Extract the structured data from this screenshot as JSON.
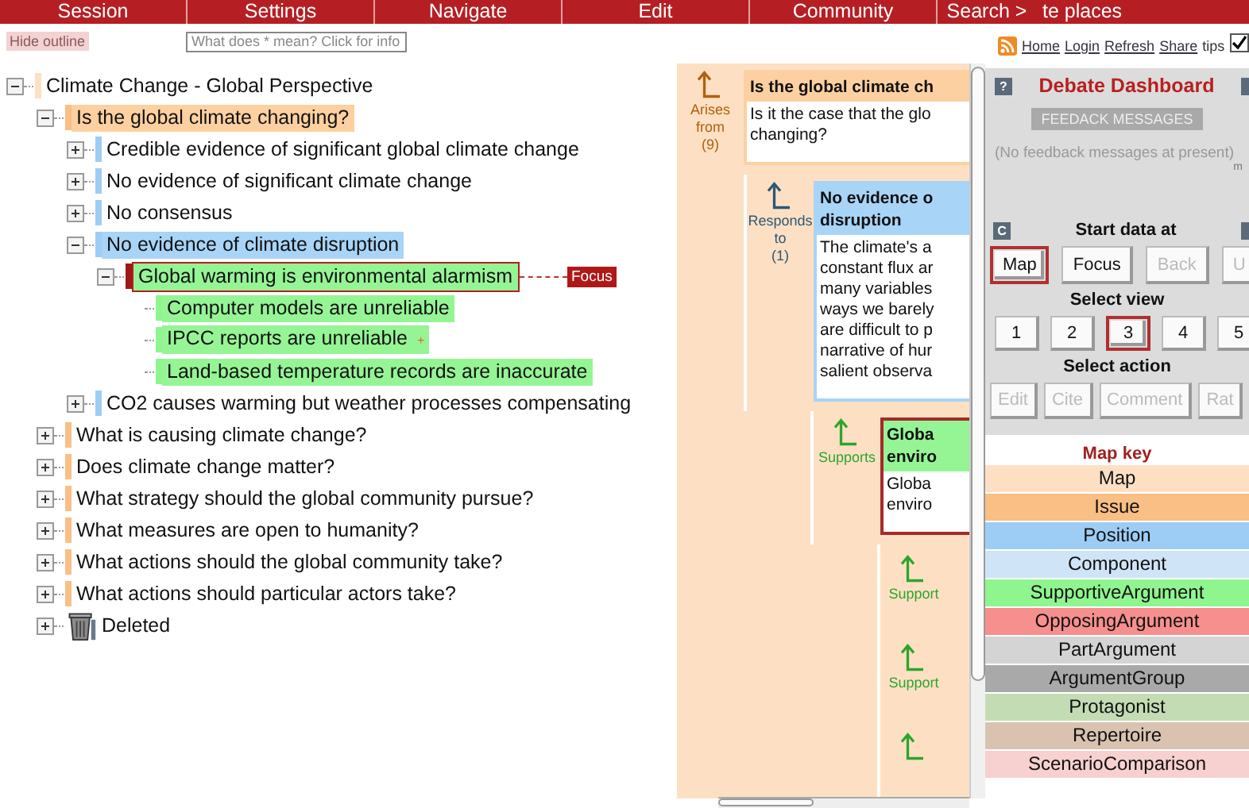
{
  "menu": [
    "Session",
    "Settings",
    "Navigate",
    "Edit",
    "Community",
    "Search >",
    "te places"
  ],
  "outline": {
    "hide_button": "Hide outline",
    "info_hint": "What does * mean? Click for info",
    "tree": [
      {
        "label": "Climate Change - Global Perspective",
        "kind": "map",
        "expanded": true,
        "highlighted": false,
        "children": [
          {
            "label": "Is the global climate changing?",
            "kind": "issue",
            "expanded": true,
            "highlighted": true,
            "children": [
              {
                "label": "Credible evidence of significant global climate change",
                "kind": "position",
                "expanded": false,
                "highlighted": false
              },
              {
                "label": "No evidence of significant climate change",
                "kind": "position",
                "expanded": false,
                "highlighted": false
              },
              {
                "label": "No consensus",
                "kind": "position",
                "expanded": false,
                "highlighted": false
              },
              {
                "label": "No evidence of climate disruption",
                "kind": "position",
                "expanded": true,
                "highlighted": true,
                "children": [
                  {
                    "label": "Global warming is environmental alarmism",
                    "kind": "supportive",
                    "expanded": true,
                    "highlighted": true,
                    "focus_tag": "Focus",
                    "children": [
                      {
                        "label": "Computer models are unreliable",
                        "kind": "supportive",
                        "highlighted": true
                      },
                      {
                        "label": "IPCC reports are unreliable",
                        "kind": "supportive",
                        "highlighted": true,
                        "marker": "+"
                      },
                      {
                        "label": "Land-based temperature records are inaccurate",
                        "kind": "supportive",
                        "highlighted": true
                      }
                    ]
                  }
                ]
              },
              {
                "label": "CO2 causes warming but weather processes compensating",
                "kind": "position",
                "expanded": false,
                "highlighted": false
              }
            ]
          },
          {
            "label": "What is causing climate change?",
            "kind": "issue",
            "expanded": false,
            "highlighted": false
          },
          {
            "label": "Does climate change matter?",
            "kind": "issue",
            "expanded": false,
            "highlighted": false
          },
          {
            "label": "What strategy should the global community pursue?",
            "kind": "issue",
            "expanded": false,
            "highlighted": false
          },
          {
            "label": "What measures are open to humanity?",
            "kind": "issue",
            "expanded": false,
            "highlighted": false
          },
          {
            "label": "What actions should the global community take?",
            "kind": "issue",
            "expanded": false,
            "highlighted": false
          },
          {
            "label": "What actions should particular actors take?",
            "kind": "issue",
            "expanded": false,
            "highlighted": false
          },
          {
            "label": "Deleted",
            "kind": "deleted",
            "expanded": false,
            "highlighted": false
          }
        ]
      }
    ]
  },
  "map": {
    "levels": [
      {
        "link": {
          "kind": "arises",
          "lines": [
            "Arises",
            "from",
            "(9)"
          ]
        },
        "node": {
          "kind": "issue",
          "focus": false,
          "title_lines": [
            "Is the global climate ch"
          ],
          "body_lines": [
            "Is it the case that the glo",
            "changing?"
          ]
        }
      },
      {
        "link": {
          "kind": "responds",
          "lines": [
            "Responds",
            "to",
            "(1)"
          ]
        },
        "node": {
          "kind": "position",
          "focus": false,
          "title_lines": [
            "No evidence o",
            "disruption"
          ],
          "body_lines": [
            "The climate's a",
            "constant flux ar",
            "many variables",
            "ways we barely",
            "are difficult to p",
            "narrative of hur",
            "salient observa"
          ]
        }
      },
      {
        "link": {
          "kind": "supports",
          "lines": [
            "Supports"
          ]
        },
        "node": {
          "kind": "supportive",
          "focus": true,
          "title_lines": [
            "Globa",
            "enviro"
          ],
          "body_lines": [
            "Globa",
            "enviro"
          ]
        }
      }
    ],
    "links": [
      {
        "kind": "supports",
        "label": "Support"
      },
      {
        "kind": "supports",
        "label": "Support"
      },
      {
        "kind": "supports"
      }
    ]
  },
  "top_links": [
    "Home",
    "Login",
    "Refresh",
    "Share"
  ],
  "tips": "tips",
  "tips_checked": true,
  "dashboard": {
    "help_icon": "?",
    "title": "Debate Dashboard",
    "feedback_button": "FEEDACK MESSAGES",
    "feedback_text": "(No feedback messages at present)",
    "feedback_more": "m",
    "section_icon": "C",
    "start_label": "Start data at",
    "start_buttons": [
      {
        "label": "Map",
        "selected": true,
        "disabled": false
      },
      {
        "label": "Focus",
        "selected": false,
        "disabled": false
      },
      {
        "label": "Back",
        "selected": false,
        "disabled": true
      },
      {
        "label": "U",
        "selected": false,
        "disabled": true
      }
    ],
    "view_label": "Select view",
    "view_buttons": [
      {
        "label": "1",
        "selected": false
      },
      {
        "label": "2",
        "selected": false
      },
      {
        "label": "3",
        "selected": true
      },
      {
        "label": "4",
        "selected": false
      },
      {
        "label": "5",
        "selected": false
      }
    ],
    "action_label": "Select action",
    "action_buttons": [
      {
        "label": "Edit",
        "disabled": true
      },
      {
        "label": "Cite",
        "disabled": true
      },
      {
        "label": "Comment",
        "disabled": true
      },
      {
        "label": "Rat",
        "disabled": true
      }
    ]
  },
  "map_key": {
    "title": "Map key",
    "items": [
      {
        "label": "Map",
        "color": "#fde0c4"
      },
      {
        "label": "Issue",
        "color": "#f9bf85"
      },
      {
        "label": "Position",
        "color": "#9dcdf5"
      },
      {
        "label": "Component",
        "color": "#cfe4f7"
      },
      {
        "label": "SupportiveArgument",
        "color": "#8ff58f"
      },
      {
        "label": "OpposingArgument",
        "color": "#f78f8f"
      },
      {
        "label": "PartArgument",
        "color": "#d4d4d4"
      },
      {
        "label": "ArgumentGroup",
        "color": "#a9a9a9"
      },
      {
        "label": "Protagonist",
        "color": "#c4dcb4"
      },
      {
        "label": "Repertoire",
        "color": "#d9c3b0"
      },
      {
        "label": "ScenarioComparison",
        "color": "#f7d0d0"
      }
    ]
  }
}
